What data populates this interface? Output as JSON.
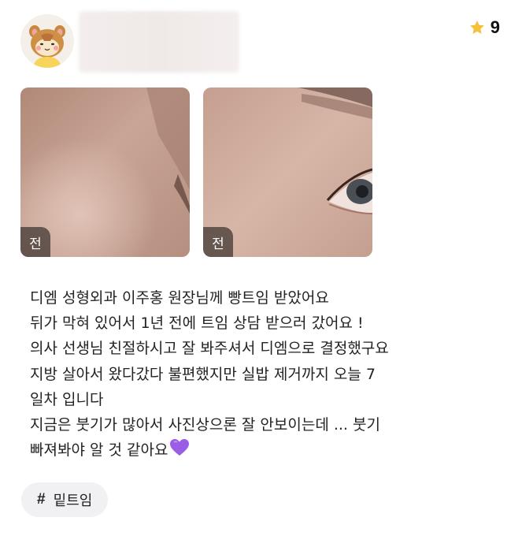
{
  "user": {
    "avatar_icon": "hamster-avatar-icon",
    "rating": "9",
    "rating_icon": "star-icon",
    "accent_color": "#f4c13a"
  },
  "photos": [
    {
      "label": "전"
    },
    {
      "label": "전"
    }
  ],
  "review": {
    "lines": [
      "디엠 성형외과 이주홍 원장님께 빵트임 받았어요",
      "뒤가 막혀 있어서 1년 전에 트임 상담 받으러 갔어요 !",
      "의사 선생님 친절하시고 잘 봐주셔서 디엠으로 결정했구요",
      "지방 살아서 왔다갔다 불편했지만 실밥 제거까지 오늘 7",
      "일차 입니다",
      "지금은 붓기가 많아서 사진상으론 잘 안보이는데 ... 붓기",
      "빠져봐야 알 것 같아요"
    ],
    "emoji_icon": "purple-heart-icon"
  },
  "hashtag": {
    "symbol": "#",
    "text": "밑트임"
  }
}
